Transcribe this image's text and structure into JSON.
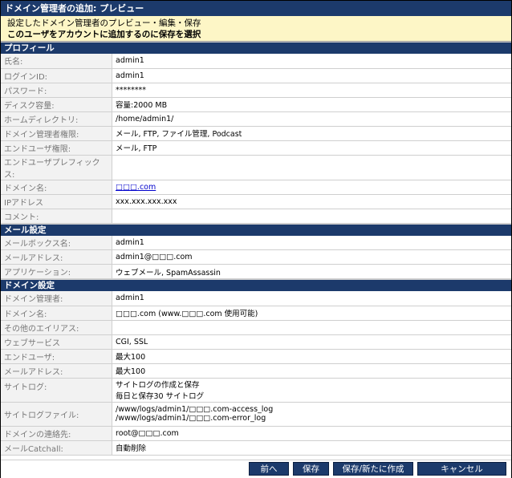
{
  "window": {
    "title": "ドメイン管理者の追加: プレビュー"
  },
  "notice": {
    "line1": "設定したドメイン管理者のプレビュー・編集・保存",
    "line2": "このユーザをアカウントに追加するのに保存を選択"
  },
  "sections": {
    "profile": {
      "title": "プロフィール",
      "rows": [
        {
          "label": "氏名:",
          "value": "admin1"
        },
        {
          "label": "ログインID:",
          "value": "admin1"
        },
        {
          "label": "パスワード:",
          "value": "********"
        },
        {
          "label": "ディスク容量:",
          "value": "容量:2000 MB"
        },
        {
          "label": "ホームディレクトリ:",
          "value": "/home/admin1/"
        },
        {
          "label": "ドメイン管理者権限:",
          "value": "メール, FTP, ファイル管理, Podcast"
        },
        {
          "label": "エンドユーザ権限:",
          "value": "メール, FTP"
        },
        {
          "label": "エンドユーザプレフィックス:",
          "value": ""
        },
        {
          "label": "ドメイン名:",
          "value": "□□□.com"
        },
        {
          "label": "IPアドレス",
          "value": "xxx.xxx.xxx.xxx"
        },
        {
          "label": "コメント:",
          "value": ""
        }
      ]
    },
    "mail": {
      "title": "メール設定",
      "rows": [
        {
          "label": "メールボックス名:",
          "value": "admin1"
        },
        {
          "label": "メールアドレス:",
          "value": "admin1@□□□.com"
        },
        {
          "label": "アプリケーション:",
          "value": "ウェブメール, SpamAssassin"
        }
      ]
    },
    "domain": {
      "title": "ドメイン設定",
      "rows": [
        {
          "label": "ドメイン管理者:",
          "value": "admin1"
        },
        {
          "label": "ドメイン名:",
          "value": "□□□.com (www.□□□.com 使用可能)"
        },
        {
          "label": "その他のエイリアス:",
          "value": ""
        },
        {
          "label": "ウェブサービス",
          "value": "CGI, SSL"
        },
        {
          "label": "エンドユーザ:",
          "value": "最大100"
        },
        {
          "label": "メールアドレス:",
          "value": "最大100"
        },
        {
          "label": "サイトログ:",
          "value": "サイトログの作成と保存",
          "value2": "毎日と保存30 サイトログ"
        },
        {
          "label": "サイトログファイル:",
          "value": "/www/logs/admin1/□□□.com-access_log",
          "value2": "/www/logs/admin1/□□□.com-error_log"
        },
        {
          "label": "ドメインの連絡先:",
          "value": "root@□□□.com"
        },
        {
          "label": "メールCatchall:",
          "value": "自動削除"
        }
      ]
    }
  },
  "footer": {
    "back_label": "前へ",
    "save_label": "保存",
    "save_new_label": "保存/新たに作成",
    "cancel_label": "キャンセル"
  },
  "colors": {
    "header_bg": "#1c3a6b",
    "notice_bg": "#fdf6c6",
    "label_bg": "#f2f2f2",
    "link": "#0000cc"
  }
}
